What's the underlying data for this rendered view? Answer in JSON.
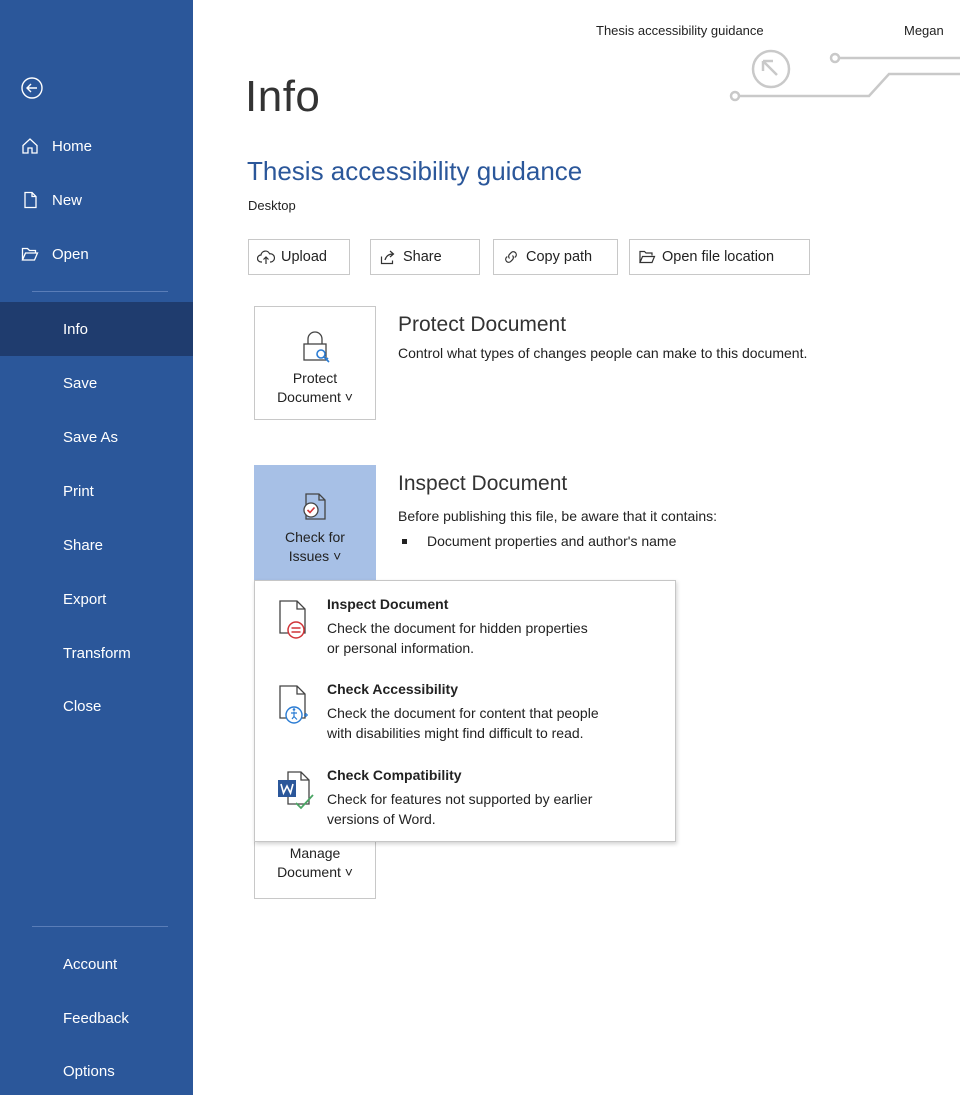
{
  "titlebar": {
    "doc_name": "Thesis accessibility guidance",
    "user_name": "Megan"
  },
  "sidebar": {
    "bg_color": "#2b579a",
    "active_color": "#1f3c6e",
    "back_icon": "back-arrow-icon",
    "top_items": [
      {
        "label": "Home",
        "icon": "home-icon"
      },
      {
        "label": "New",
        "icon": "new-document-icon"
      },
      {
        "label": "Open",
        "icon": "open-folder-icon"
      }
    ],
    "items": [
      {
        "label": "Info"
      },
      {
        "label": "Save"
      },
      {
        "label": "Save As"
      },
      {
        "label": "Print"
      },
      {
        "label": "Share"
      },
      {
        "label": "Export"
      },
      {
        "label": "Transform"
      },
      {
        "label": "Close"
      }
    ],
    "bottom_items": [
      {
        "label": "Account"
      },
      {
        "label": "Feedback"
      },
      {
        "label": "Options"
      }
    ]
  },
  "main": {
    "page_title": "Info",
    "doc_title": "Thesis accessibility guidance",
    "doc_location": "Desktop",
    "actions": [
      {
        "label": "Upload",
        "icon": "cloud-upload-icon"
      },
      {
        "label": "Share",
        "icon": "share-icon"
      },
      {
        "label": "Copy path",
        "icon": "link-icon"
      },
      {
        "label": "Open file location",
        "icon": "folder-icon"
      }
    ],
    "protect": {
      "button_line1": "Protect",
      "button_line2": "Document ˅",
      "heading": "Protect Document",
      "desc": "Control what types of changes people can make to this document."
    },
    "inspect": {
      "button_line1": "Check for",
      "button_line2": "Issues ˅",
      "heading": "Inspect Document",
      "desc": "Before publishing this file, be aware that it contains:",
      "bullet": "Document properties and author's name"
    },
    "manage": {
      "button_line1": "Manage",
      "button_line2": "Document ˅"
    }
  },
  "dropdown": {
    "items": [
      {
        "title": "Inspect Document",
        "desc_line1": "Check the document for hidden properties",
        "desc_line2": "or personal information.",
        "icon": "inspect-document-icon"
      },
      {
        "title": "Check Accessibility",
        "desc_line1": "Check the document for content that people",
        "desc_line2": "with disabilities might find difficult to read.",
        "icon": "accessibility-checker-icon"
      },
      {
        "title": "Check Compatibility",
        "desc_line1": "Check for features not supported by earlier",
        "desc_line2": "versions of Word.",
        "icon": "compatibility-checker-icon"
      }
    ]
  }
}
